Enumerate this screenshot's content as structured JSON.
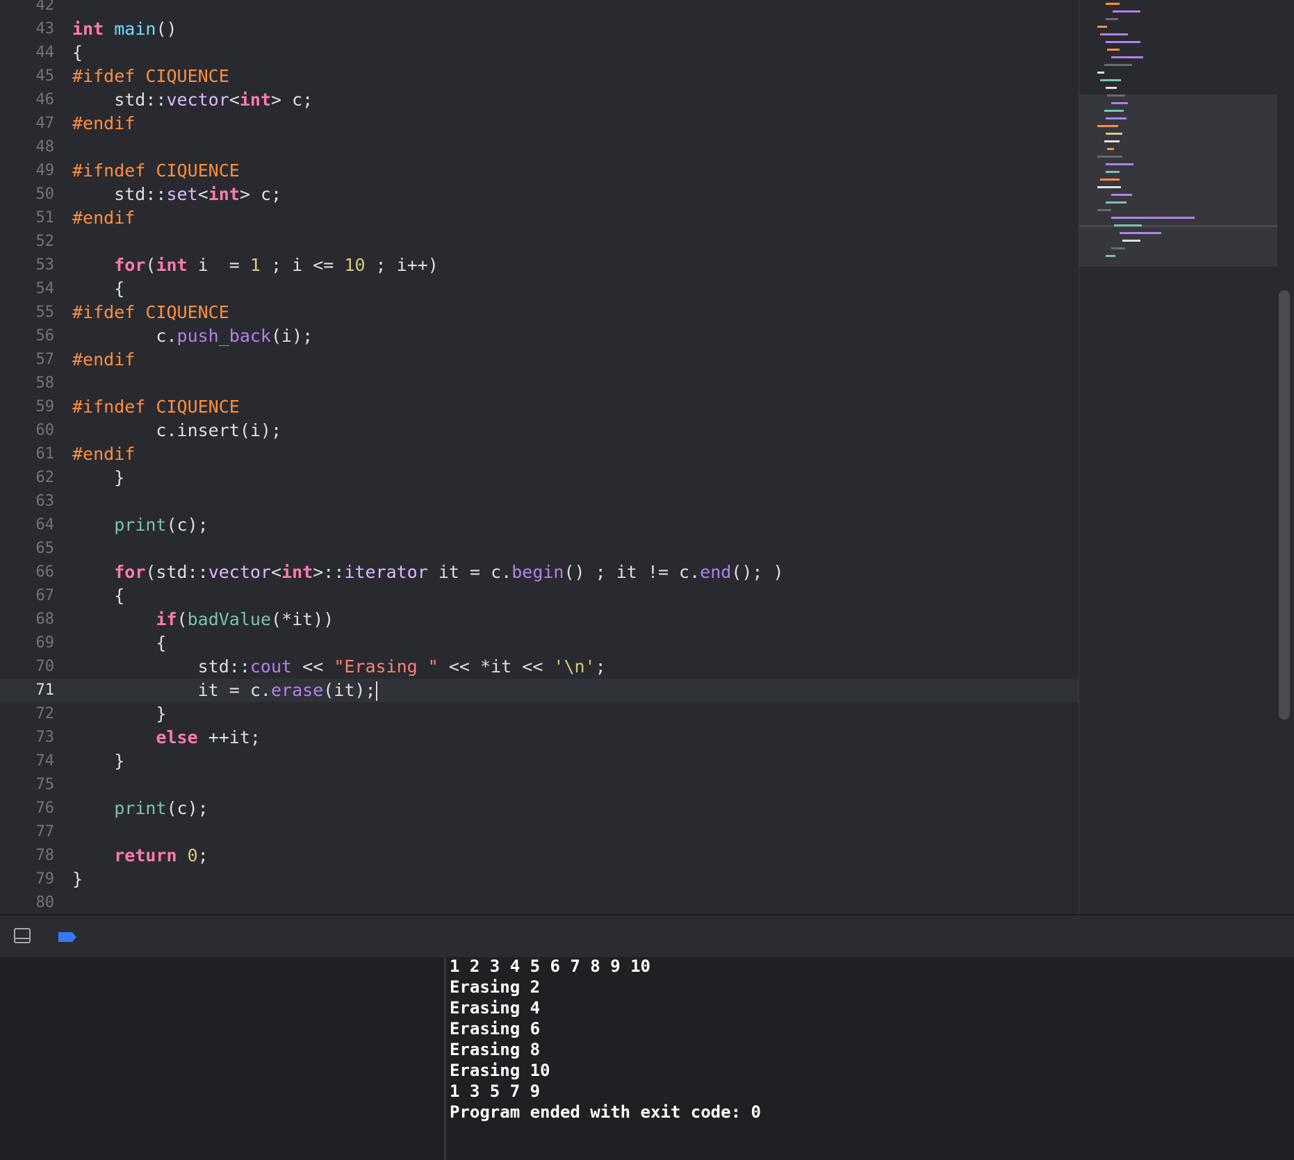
{
  "editor": {
    "current_line": "71",
    "lines": [
      {
        "n": "42",
        "tokens": []
      },
      {
        "n": "43",
        "tokens": [
          {
            "t": "int",
            "c": "kw"
          },
          {
            "t": " "
          },
          {
            "t": "main",
            "c": "fn"
          },
          {
            "t": "()"
          }
        ]
      },
      {
        "n": "44",
        "tokens": [
          {
            "t": "{"
          }
        ]
      },
      {
        "n": "45",
        "tokens": [
          {
            "t": "#ifdef CIQUENCE",
            "c": "pp"
          }
        ]
      },
      {
        "n": "46",
        "tokens": [
          {
            "t": "    std::"
          },
          {
            "t": "vector",
            "c": "lib2"
          },
          {
            "t": "<"
          },
          {
            "t": "int",
            "c": "kw"
          },
          {
            "t": "> c;"
          }
        ]
      },
      {
        "n": "47",
        "tokens": [
          {
            "t": "#endif",
            "c": "pp"
          }
        ]
      },
      {
        "n": "48",
        "tokens": []
      },
      {
        "n": "49",
        "tokens": [
          {
            "t": "#ifndef CIQUENCE",
            "c": "pp"
          }
        ]
      },
      {
        "n": "50",
        "tokens": [
          {
            "t": "    std::"
          },
          {
            "t": "set",
            "c": "lib2"
          },
          {
            "t": "<"
          },
          {
            "t": "int",
            "c": "kw"
          },
          {
            "t": "> c;"
          }
        ]
      },
      {
        "n": "51",
        "tokens": [
          {
            "t": "#endif",
            "c": "pp"
          }
        ]
      },
      {
        "n": "52",
        "tokens": []
      },
      {
        "n": "53",
        "tokens": [
          {
            "t": "    "
          },
          {
            "t": "for",
            "c": "kw"
          },
          {
            "t": "("
          },
          {
            "t": "int",
            "c": "kw"
          },
          {
            "t": " i  = "
          },
          {
            "t": "1",
            "c": "num"
          },
          {
            "t": " ; i <= "
          },
          {
            "t": "10",
            "c": "num"
          },
          {
            "t": " ; i++)"
          }
        ]
      },
      {
        "n": "54",
        "tokens": [
          {
            "t": "    {"
          }
        ]
      },
      {
        "n": "55",
        "tokens": [
          {
            "t": "#ifdef CIQUENCE",
            "c": "pp"
          }
        ]
      },
      {
        "n": "56",
        "tokens": [
          {
            "t": "        c."
          },
          {
            "t": "push_back",
            "c": "lib"
          },
          {
            "t": "(i);"
          }
        ]
      },
      {
        "n": "57",
        "tokens": [
          {
            "t": "#endif",
            "c": "pp"
          }
        ]
      },
      {
        "n": "58",
        "tokens": []
      },
      {
        "n": "59",
        "tokens": [
          {
            "t": "#ifndef CIQUENCE",
            "c": "pp"
          }
        ]
      },
      {
        "n": "60",
        "tokens": [
          {
            "t": "        c.insert(i);"
          }
        ]
      },
      {
        "n": "61",
        "tokens": [
          {
            "t": "#endif",
            "c": "pp"
          }
        ]
      },
      {
        "n": "62",
        "tokens": [
          {
            "t": "    }"
          }
        ]
      },
      {
        "n": "63",
        "tokens": []
      },
      {
        "n": "64",
        "tokens": [
          {
            "t": "    "
          },
          {
            "t": "print",
            "c": "proj"
          },
          {
            "t": "(c);"
          }
        ]
      },
      {
        "n": "65",
        "tokens": []
      },
      {
        "n": "66",
        "tokens": [
          {
            "t": "    "
          },
          {
            "t": "for",
            "c": "kw"
          },
          {
            "t": "(std::"
          },
          {
            "t": "vector",
            "c": "lib2"
          },
          {
            "t": "<"
          },
          {
            "t": "int",
            "c": "kw"
          },
          {
            "t": ">::"
          },
          {
            "t": "iterator",
            "c": "lib2"
          },
          {
            "t": " it = c."
          },
          {
            "t": "begin",
            "c": "lib"
          },
          {
            "t": "() ; it != c."
          },
          {
            "t": "end",
            "c": "lib"
          },
          {
            "t": "(); )"
          }
        ]
      },
      {
        "n": "67",
        "tokens": [
          {
            "t": "    {"
          }
        ]
      },
      {
        "n": "68",
        "tokens": [
          {
            "t": "        "
          },
          {
            "t": "if",
            "c": "kw"
          },
          {
            "t": "("
          },
          {
            "t": "badValue",
            "c": "proj"
          },
          {
            "t": "(*it))"
          }
        ]
      },
      {
        "n": "69",
        "tokens": [
          {
            "t": "        {"
          }
        ]
      },
      {
        "n": "70",
        "tokens": [
          {
            "t": "            std::"
          },
          {
            "t": "cout",
            "c": "lib"
          },
          {
            "t": " << "
          },
          {
            "t": "\"Erasing \"",
            "c": "str"
          },
          {
            "t": " << *it << "
          },
          {
            "t": "'\\n'",
            "c": "num"
          },
          {
            "t": ";"
          }
        ]
      },
      {
        "n": "71",
        "tokens": [
          {
            "t": "            it = c."
          },
          {
            "t": "erase",
            "c": "lib"
          },
          {
            "t": "(it);"
          }
        ],
        "caret": true
      },
      {
        "n": "72",
        "tokens": [
          {
            "t": "        }"
          }
        ]
      },
      {
        "n": "73",
        "tokens": [
          {
            "t": "        "
          },
          {
            "t": "else",
            "c": "kw"
          },
          {
            "t": " ++it;"
          }
        ]
      },
      {
        "n": "74",
        "tokens": [
          {
            "t": "    }"
          }
        ]
      },
      {
        "n": "75",
        "tokens": []
      },
      {
        "n": "76",
        "tokens": [
          {
            "t": "    "
          },
          {
            "t": "print",
            "c": "proj"
          },
          {
            "t": "(c);"
          }
        ]
      },
      {
        "n": "77",
        "tokens": []
      },
      {
        "n": "78",
        "tokens": [
          {
            "t": "    "
          },
          {
            "t": "return",
            "c": "kw"
          },
          {
            "t": " "
          },
          {
            "t": "0",
            "c": "num"
          },
          {
            "t": ";"
          }
        ]
      },
      {
        "n": "79",
        "tokens": [
          {
            "t": "}"
          }
        ]
      },
      {
        "n": "80",
        "tokens": []
      }
    ]
  },
  "colors": {
    "keyword": "#ff7ab2",
    "preprocessor": "#fd8f3f",
    "number": "#d9c97c",
    "string": "#ff8170",
    "project_function": "#78c2b3",
    "library_method": "#b281eb",
    "library_type": "#dabaff",
    "declaration": "#6bdfff",
    "plain_text": "#dfdfe0",
    "breakpoint_toggle": "#3478f6"
  },
  "debug_bar": {
    "hide_panel_icon": "panel-toggle-icon",
    "breakpoints_icon": "breakpoint-toggle-icon"
  },
  "console": {
    "lines": [
      "1 2 3 4 5 6 7 8 9 10",
      "Erasing 2",
      "Erasing 4",
      "Erasing 6",
      "Erasing 8",
      "Erasing 10",
      "1 3 5 7 9",
      "Program ended with exit code: 0"
    ]
  }
}
